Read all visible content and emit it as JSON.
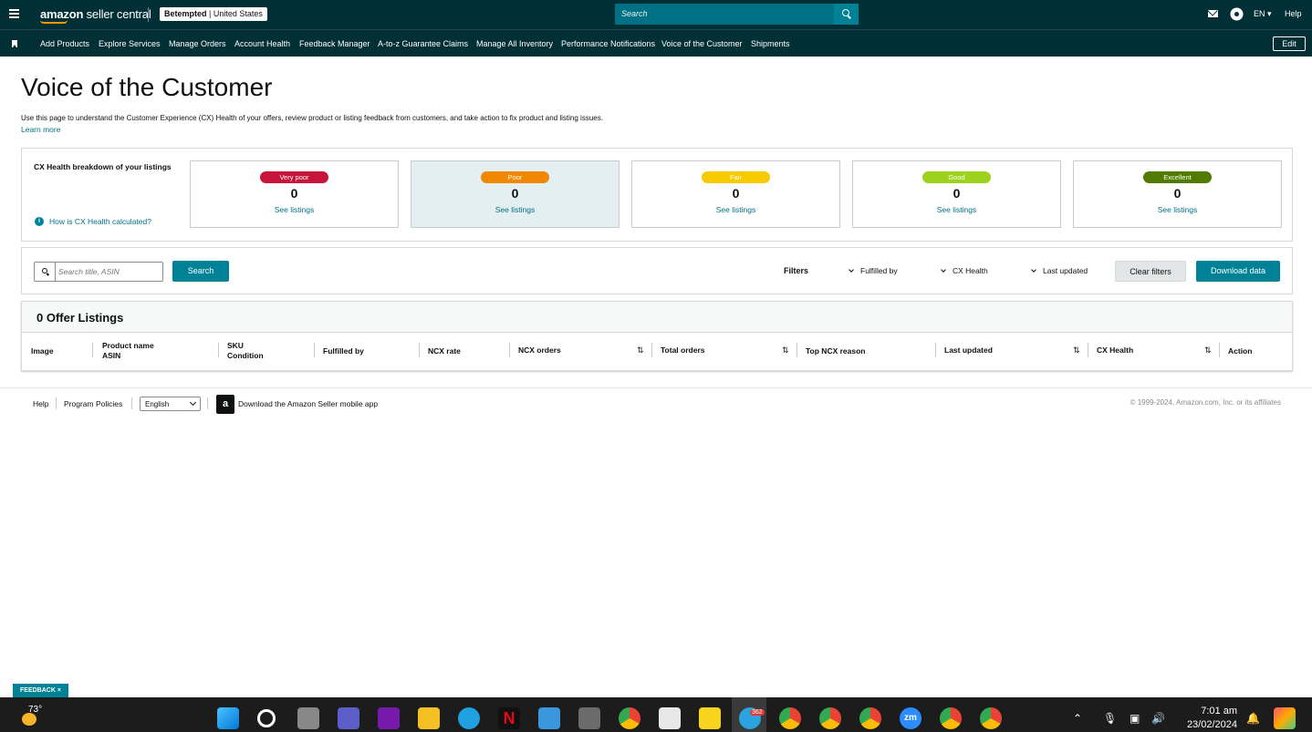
{
  "topbar": {
    "logo_text": "amazon",
    "logo_text2": " seller central",
    "store_name": "Betempted",
    "store_region": "United States",
    "search_placeholder": "Search",
    "language": "EN",
    "help": "Help"
  },
  "nav": {
    "items": [
      "Add Products",
      "Explore Services",
      "Manage Orders",
      "Account Health",
      "Feedback Manager",
      "A-to-z Guarantee Claims",
      "Manage All Inventory",
      "Performance Notifications",
      "Voice of the Customer",
      "Shipments"
    ],
    "edit": "Edit"
  },
  "page": {
    "title": "Voice of the Customer",
    "description": "Use this page to understand the Customer Experience (CX) Health of your offers, review product or listing feedback from customers, and take action to fix product and listing issues.",
    "learn_more": "Learn more"
  },
  "cx": {
    "heading": "CX Health breakdown of your listings",
    "how_link": "How is CX Health calculated?",
    "cards": [
      {
        "label": "Very poor",
        "count": "0",
        "link": "See listings",
        "color": "#c7153a"
      },
      {
        "label": "Poor",
        "count": "0",
        "link": "See listings",
        "color": "#f08804"
      },
      {
        "label": "Fair",
        "count": "0",
        "link": "See listings",
        "color": "#f7ca00"
      },
      {
        "label": "Good",
        "count": "0",
        "link": "See listings",
        "color": "#9cd11c"
      },
      {
        "label": "Excellent",
        "count": "0",
        "link": "See listings",
        "color": "#507b00"
      }
    ]
  },
  "filters": {
    "search_placeholder": "Search title, ASIN",
    "search_button": "Search",
    "filters_label": "Filters",
    "fulfilled_by": "Fulfilled by",
    "cx_health": "CX Health",
    "last_updated": "Last updated",
    "clear": "Clear filters",
    "download": "Download data"
  },
  "table": {
    "count_title": "0 Offer Listings",
    "col_image": "Image",
    "col_product_name": "Product name",
    "col_asin": "ASIN",
    "col_sku": "SKU",
    "col_condition": "Condition",
    "col_fulfilled": "Fulfilled by",
    "col_ncx_rate": "NCX rate",
    "col_ncx_orders": "NCX orders",
    "col_total_orders": "Total orders",
    "col_top_reason": "Top NCX reason",
    "col_last_updated": "Last updated",
    "col_cx_health": "CX Health",
    "col_action": "Action"
  },
  "footer": {
    "help": "Help",
    "policies": "Program Policies",
    "language": "English",
    "app_link": "Download the Amazon Seller mobile app",
    "copyright": "© 1999-2024, Amazon.com, Inc. or its affiliates"
  },
  "feedback": "FEEDBACK ×",
  "taskbar": {
    "temperature": "73°",
    "time": "7:01 am",
    "date": "23/02/2024",
    "telegram_badge": "362"
  }
}
